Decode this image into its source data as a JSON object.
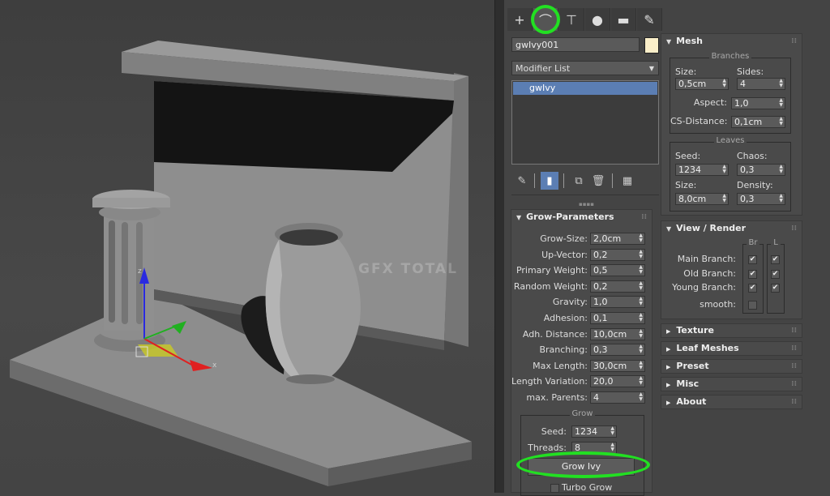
{
  "tabs": [
    {
      "name": "create-tab",
      "glyph": "+"
    },
    {
      "name": "modify-tab",
      "glyph": "⌒"
    },
    {
      "name": "hierarchy-tab",
      "glyph": "⊤"
    },
    {
      "name": "motion-tab",
      "glyph": "●"
    },
    {
      "name": "display-tab",
      "glyph": "▬"
    },
    {
      "name": "utilities-tab",
      "glyph": "✎"
    }
  ],
  "object": {
    "name": "gwIvy001",
    "color": "#fbefc9"
  },
  "modifier_list": {
    "label": "Modifier List"
  },
  "stack": {
    "items": [
      "gwIvy"
    ]
  },
  "viewport": {
    "watermark": "GFX TOTAL",
    "axis_x": "x",
    "axis_z": "z"
  },
  "grow_parameters": {
    "title": "Grow-Parameters",
    "rows": [
      {
        "label": "Grow-Size:",
        "value": "2,0cm"
      },
      {
        "label": "Up-Vector:",
        "value": "0,2"
      },
      {
        "label": "Primary Weight:",
        "value": "0,5"
      },
      {
        "label": "Random Weight:",
        "value": "0,2"
      },
      {
        "label": "Gravity:",
        "value": "1,0"
      },
      {
        "label": "Adhesion:",
        "value": "0,1"
      },
      {
        "label": "Adh. Distance:",
        "value": "10,0cm"
      },
      {
        "label": "Branching:",
        "value": "0,3"
      },
      {
        "label": "Max Length:",
        "value": "30,0cm"
      },
      {
        "label": "Length Variation:",
        "value": "20,0"
      },
      {
        "label": "max. Parents:",
        "value": "4"
      }
    ],
    "grow_group": {
      "title": "Grow",
      "seed_label": "Seed:",
      "seed_value": "1234",
      "threads_label": "Threads:",
      "threads_value": "8",
      "grow_button": "Grow Ivy",
      "turbo_label": "Turbo Grow"
    }
  },
  "mesh": {
    "title": "Mesh",
    "branches": {
      "title": "Branches",
      "size_label": "Size:",
      "size_value": "0,5cm",
      "sides_label": "Sides:",
      "sides_value": "4",
      "aspect_label": "Aspect:",
      "aspect_value": "1,0",
      "csd_label": "CS-Distance:",
      "csd_value": "0,1cm"
    },
    "leaves": {
      "title": "Leaves",
      "seed_label": "Seed:",
      "seed_value": "1234",
      "chaos_label": "Chaos:",
      "chaos_value": "0,3",
      "size_label": "Size:",
      "size_value": "8,0cm",
      "density_label": "Density:",
      "density_value": "0,3"
    }
  },
  "view_render": {
    "title": "View / Render",
    "col_br": "Br",
    "col_l": "L",
    "rows": [
      {
        "label": "Main Branch:",
        "br": true,
        "l": true
      },
      {
        "label": "Old Branch:",
        "br": true,
        "l": true
      },
      {
        "label": "Young Branch:",
        "br": true,
        "l": true
      }
    ],
    "smooth_label": "smooth:"
  },
  "collapsed_rollups": [
    "Texture",
    "Leaf Meshes",
    "Preset",
    "Misc",
    "About"
  ]
}
